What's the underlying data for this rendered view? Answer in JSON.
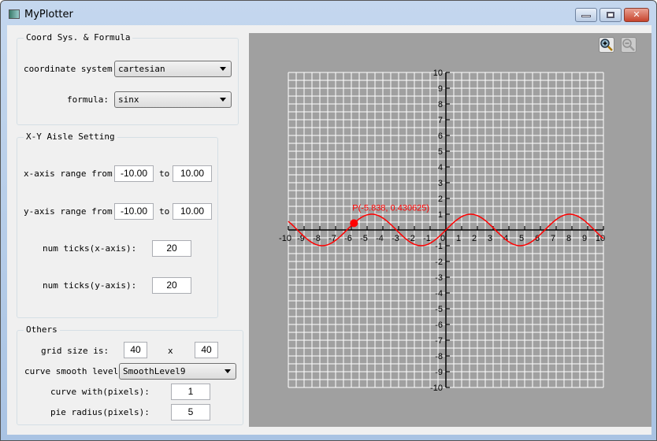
{
  "window": {
    "title": "MyPlotter"
  },
  "coord_group": {
    "title": "Coord Sys. & Formula",
    "coord_label": "coordinate system:",
    "coord_value": "cartesian",
    "formula_label": "formula:",
    "formula_value": "sinx"
  },
  "xy_group": {
    "title": "X-Y Aisle Setting",
    "x_label": "x-axis range from:",
    "x_from": "-10.00",
    "x_to": "10.00",
    "y_label": "y-axis range from:",
    "y_from": "-10.00",
    "y_to": "10.00",
    "to": "to",
    "xticks_label": "num ticks(x-axis):",
    "xticks": "20",
    "yticks_label": "num ticks(y-axis):",
    "yticks": "20"
  },
  "others": {
    "title": "Others",
    "grid_label": "grid size is:",
    "grid_x": "40",
    "x": "x",
    "grid_y": "40",
    "smooth_label": "curve smooth level:",
    "smooth_value": "SmoothLevel9",
    "width_label": "curve with(pixels):",
    "width_value": "1",
    "radius_label": "pie radius(pixels):",
    "radius_value": "5"
  },
  "chart_data": {
    "type": "line",
    "formula": "sin(x)",
    "xlim": [
      -10,
      10
    ],
    "ylim": [
      -10,
      10
    ],
    "x_ticks": [
      -10,
      -9,
      -8,
      -7,
      -6,
      -5,
      -4,
      -3,
      -2,
      -1,
      0,
      1,
      2,
      3,
      4,
      5,
      6,
      7,
      8,
      9,
      10
    ],
    "y_ticks": [
      -10,
      -9,
      -8,
      -7,
      -6,
      -5,
      -4,
      -3,
      -2,
      -1,
      1,
      2,
      3,
      4,
      5,
      6,
      7,
      8,
      9,
      10
    ],
    "grid": true,
    "grid_cells": [
      40,
      40
    ],
    "curve_color": "#ff0000",
    "point": {
      "x": -5.838,
      "y": 0.430625,
      "label": "P(-5.838, 0.430625)"
    }
  }
}
